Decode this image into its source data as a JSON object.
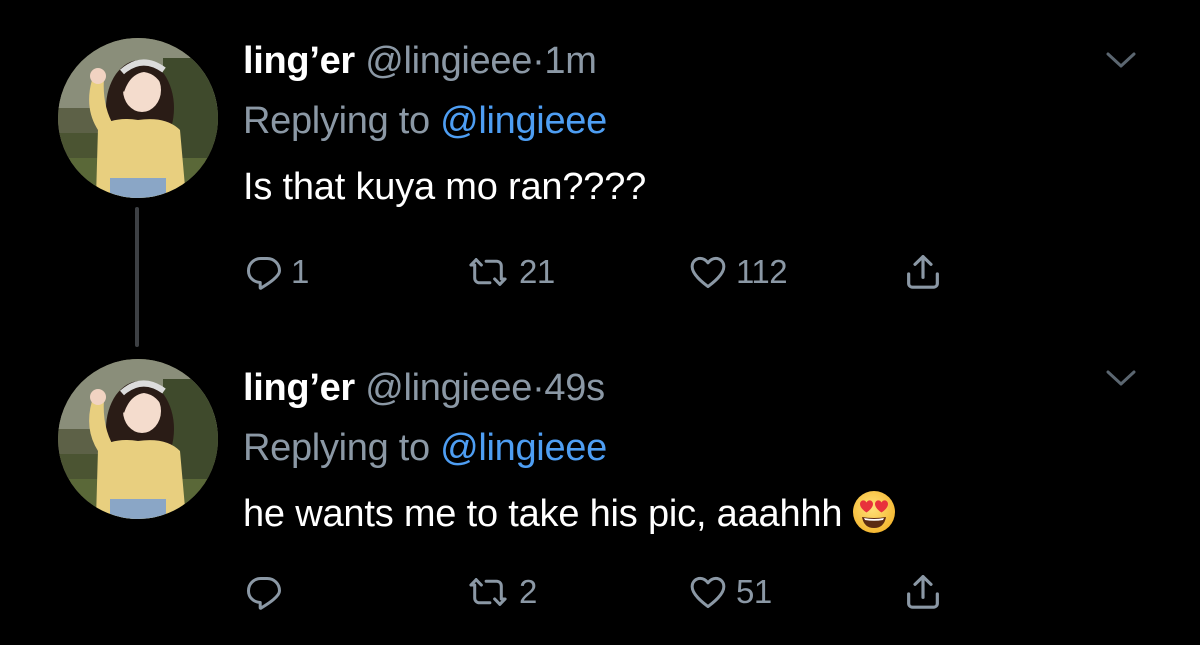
{
  "colors": {
    "background": "#000000",
    "text_primary": "#ffffff",
    "text_secondary": "#8b98a5",
    "link": "#4e9ef3",
    "thread_line": "#3d4044"
  },
  "tweets": [
    {
      "display_name": "ling’er",
      "handle": "@lingieee",
      "separator": "·",
      "time": "1m",
      "replying_prefix": "Replying to",
      "replying_to": "@lingieee",
      "text": "Is that kuya mo ran????",
      "emoji": "",
      "actions": {
        "reply_icon": "reply-icon",
        "reply_count": "1",
        "retweet_icon": "retweet-icon",
        "retweet_count": "21",
        "like_icon": "heart-icon",
        "like_count": "112",
        "share_icon": "share-icon"
      }
    },
    {
      "display_name": "ling’er",
      "handle": "@lingieee",
      "separator": "·",
      "time": "49s",
      "replying_prefix": "Replying to",
      "replying_to": "@lingieee",
      "text": "he wants me to take his pic, aaahhh",
      "emoji": "heart-eyes-emoji",
      "actions": {
        "reply_icon": "reply-icon",
        "reply_count": "",
        "retweet_icon": "retweet-icon",
        "retweet_count": "2",
        "like_icon": "heart-icon",
        "like_count": "51",
        "share_icon": "share-icon"
      }
    }
  ]
}
